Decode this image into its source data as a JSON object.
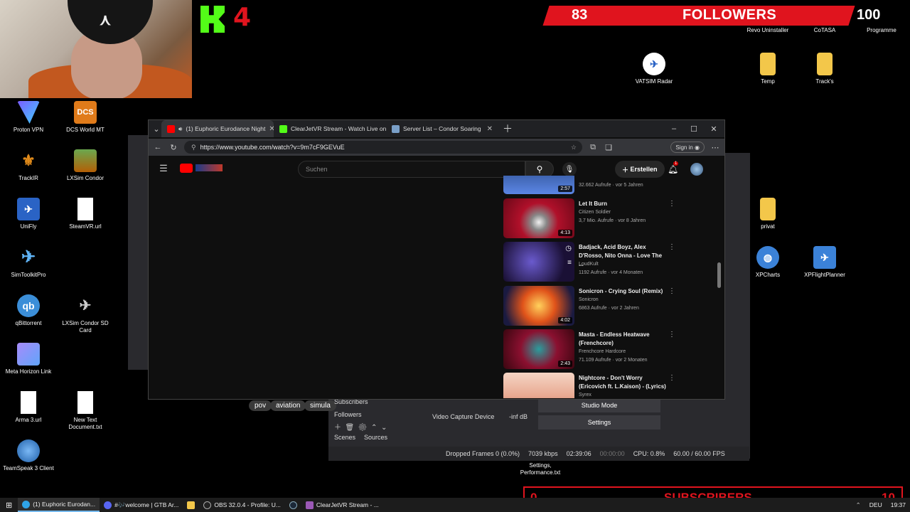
{
  "overlay": {
    "kick_count": "4",
    "followers_count": "83",
    "followers_label": "FOLLOWERS",
    "followers_goal": "100",
    "subscribers_count": "0",
    "subscribers_label": "SUBSCRIBERS",
    "subscribers_goal": "10"
  },
  "desktop": {
    "left_icons": [
      {
        "label": "Proton VPN"
      },
      {
        "label": "DCS World MT"
      },
      {
        "label": "TrackIR"
      },
      {
        "label": "LXSim Condor"
      },
      {
        "label": "UniFly"
      },
      {
        "label": "SteamVR.url"
      },
      {
        "label": "SimToolkitPro"
      },
      {
        "label": "qBittorrent"
      },
      {
        "label": "LXSim Condor SD Card"
      },
      {
        "label": "Meta Horizon Link"
      },
      {
        "label": "Arma 3.url"
      },
      {
        "label": "New Text Document.txt"
      },
      {
        "label": "TeamSpeak 3 Client"
      }
    ],
    "right_icons": [
      {
        "label": "Revo Uninstaller"
      },
      {
        "label": "CoTASA"
      },
      {
        "label": "Programme"
      },
      {
        "label": "VATSIM Radar"
      },
      {
        "label": "Temp"
      },
      {
        "label": "Track's"
      },
      {
        "label": "privat"
      },
      {
        "label": "XPCharts"
      },
      {
        "label": "XPFlightPlanner"
      },
      {
        "label": "Settings, Performance.txt"
      }
    ],
    "dcs_icon_text": "DCS"
  },
  "browser": {
    "tabs": [
      {
        "label": "(1) Euphoric Eurodance Night"
      },
      {
        "label": "ClearJetVR Stream - Watch Live on"
      },
      {
        "label": "Server List – Condor Soaring"
      }
    ],
    "url": "https://www.youtube.com/watch?v=9m7cF9GEVuE",
    "signin": "Sign in"
  },
  "youtube": {
    "search_placeholder": "Suchen",
    "create_label": "Erstellen",
    "notification_count": "1",
    "videos": [
      {
        "title": "",
        "channel": "",
        "meta": "32.662 Aufrufe · vor 5 Jahren",
        "duration": "2:57"
      },
      {
        "title": "Let It Burn",
        "channel": "Citizen Soldier",
        "meta": "3,7 Mio. Aufrufe · vor 8 Jahren",
        "duration": "4:13"
      },
      {
        "title": "Badjack, Acid Boyz, Alex D'Rosso, Nito Onna - Love The ...",
        "channel": "LoudKult",
        "meta": "1192 Aufrufe · vor 4 Monaten",
        "duration": ""
      },
      {
        "title": "Sonicron - Crying Soul (Remix)",
        "channel": "Sonicron",
        "meta": "6863 Aufrufe · vor 2 Jahren",
        "duration": "4:02"
      },
      {
        "title": "Masta - Endless Heatwave (Frenchcore)",
        "channel": "Frenchcore Hardcore",
        "meta": "71.109 Aufrufe · vor 2 Monaten",
        "duration": "2:43"
      },
      {
        "title": "Nightcore - Don't Worry (Ericovich ft. L.Kaison) - (Lyrics)",
        "channel": "Syrex",
        "meta": "",
        "duration": ""
      }
    ]
  },
  "obs": {
    "tags": [
      "pov",
      "aviation",
      "simula"
    ],
    "sources_rows": [
      "Subscribers",
      "Followers"
    ],
    "audio_device": "Video Capture Device",
    "audio_db": "-inf dB",
    "studio_mode": "Studio Mode",
    "settings": "Settings",
    "scenes_tab": "Scenes",
    "sources_tab": "Sources",
    "dropped_frames": "Dropped Frames 0 (0.0%)",
    "bitrate": "7039 kbps",
    "live_time": "02:39:06",
    "rec_time": "00:00:00",
    "cpu": "CPU: 0.8%",
    "fps": "60.00 / 60.00 FPS"
  },
  "taskbar": {
    "items": [
      {
        "label": "(1) Euphoric Eurodan..."
      },
      {
        "label": "#🎶welcome | GTB Ar..."
      },
      {
        "label": ""
      },
      {
        "label": "OBS 32.0.4 - Profile: U..."
      },
      {
        "label": ""
      },
      {
        "label": "ClearJetVR Stream - ..."
      }
    ],
    "lang": "DEU",
    "time": "19:37"
  },
  "colors": {
    "overlay_red": "#e0141e",
    "kick_green": "#53fc18",
    "youtube_red": "#ff0000"
  }
}
